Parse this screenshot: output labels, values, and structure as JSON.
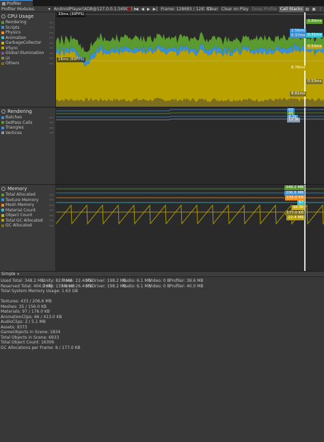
{
  "window": {
    "tab_title": "Profiler"
  },
  "toolbar": {
    "modules_label": "Profiler Modules",
    "target_label": "AndroidPlayer(ADB@127.0.0.1:34999)",
    "frame_label": "Frame: 128683 / 128703",
    "clear_label": "Clear",
    "clear_on_play_label": "Clear on Play",
    "deep_profile_label": "Deep Profile",
    "call_stacks_label": "Call Stacks"
  },
  "cpu": {
    "title": "CPU Usage",
    "items": [
      {
        "label": "Rendering",
        "color": "#5b9a2e"
      },
      {
        "label": "Scripts",
        "color": "#3b8fd6"
      },
      {
        "label": "Physics",
        "color": "#ef8f23"
      },
      {
        "label": "Animation",
        "color": "#3cc0d0"
      },
      {
        "label": "GarbageCollector",
        "color": "#c8b020"
      },
      {
        "label": "VSync",
        "color": "#b9a200"
      },
      {
        "label": "Global Illumination",
        "color": "#7a5a8a"
      },
      {
        "label": "UI",
        "color": "#8b8b3a"
      },
      {
        "label": "Others",
        "color": "#7e6f1e"
      }
    ],
    "top_label": "33ms (30FPS)",
    "mid_label": "16ms (60FPS)",
    "tags": [
      {
        "text": "3.89ms",
        "color": "#5b9a2e"
      },
      {
        "text": "2.56ms",
        "color": "#3b8fd6"
      },
      {
        "text": "0.31ms",
        "color": "#3cc0d0"
      },
      {
        "text": "0.37ms",
        "color": "#3b8fd6"
      },
      {
        "text": "5.53ms",
        "color": "#b9a200"
      },
      {
        "text": "8.78ms",
        "color": "#b9a200"
      },
      {
        "text": "0.53ms",
        "color": "#7e6f1e"
      },
      {
        "text": "8.61ms",
        "color": "#7e6f1e"
      }
    ]
  },
  "rendering": {
    "title": "Rendering",
    "items": [
      {
        "label": "Batches",
        "color": "#3b8fd6"
      },
      {
        "label": "SetPass Calls",
        "color": "#5b9a2e"
      },
      {
        "label": "Triangles",
        "color": "#3b8fd6"
      },
      {
        "label": "Vertices",
        "color": "#8a9aa8"
      }
    ],
    "tags": [
      {
        "text": "65",
        "color": "#3b8fd6"
      },
      {
        "text": "45",
        "color": "#5b9a2e"
      },
      {
        "text": "8.1k",
        "color": "#3b8fd6"
      },
      {
        "text": "12.3k",
        "color": "#8a9aa8"
      }
    ]
  },
  "memory": {
    "title": "Memory",
    "items": [
      {
        "label": "Total Allocated",
        "color": "#5b9a2e"
      },
      {
        "label": "Texture Memory",
        "color": "#3b8fd6"
      },
      {
        "label": "Mesh Memory",
        "color": "#ef8f23"
      },
      {
        "label": "Material Count",
        "color": "#3cc0d0"
      },
      {
        "label": "Object Count",
        "color": "#c8b020"
      },
      {
        "label": "Total GC Allocated",
        "color": "#b9a200"
      },
      {
        "label": "GC Allocated",
        "color": "#7e6f1e"
      }
    ],
    "tags": [
      {
        "text": "348.2 MB",
        "color": "#5b9a2e"
      },
      {
        "text": "206.6 MB",
        "color": "#3b8fd6"
      },
      {
        "text": "156.0 KB",
        "color": "#ef8f23"
      },
      {
        "text": "97",
        "color": "#3cc0d0"
      },
      {
        "text": "16.3k",
        "color": "#c8b020"
      },
      {
        "text": "177.0 KB",
        "color": "#7e6f1e"
      },
      {
        "text": "22.4 MB",
        "color": "#b9a200"
      }
    ]
  },
  "details": {
    "view_mode": "Simple",
    "used_total": [
      "Used Total: 348.2 MB",
      "Unity: 82.7 MB",
      "Mono: 22.4 MB",
      "GfxDriver: 198.2 MB",
      "Audio: 6.1 MB",
      "Video: 0 B",
      "Profiler: 38.6 MB"
    ],
    "reserved_total": [
      "Reserved Total: 404.7 MB",
      "Unity: 133.9 MB",
      "Mono: 26.4 MB",
      "GfxDriver: 198.2 MB",
      "Audio: 6.1 MB",
      "Video: 0 B",
      "Profiler: 40.0 MB"
    ],
    "system_memory": "Total System Memory Usage: 1.63 GB",
    "assets": [
      "Textures: 433 / 206.6 MB",
      "Meshes: 35 / 156.0 KB",
      "Materials: 97 / 176.0 KB",
      "AnimationClips: 66 / 413.0 KB",
      "AudioClips: 2 / 5.1 MB",
      "Assets: 9373",
      "GameObjects in Scene: 1834",
      "Total Objects in Scene: 6933",
      "Total Object Count: 16306",
      "GC Allocations per Frame: 8 / 177.0 KB"
    ]
  }
}
